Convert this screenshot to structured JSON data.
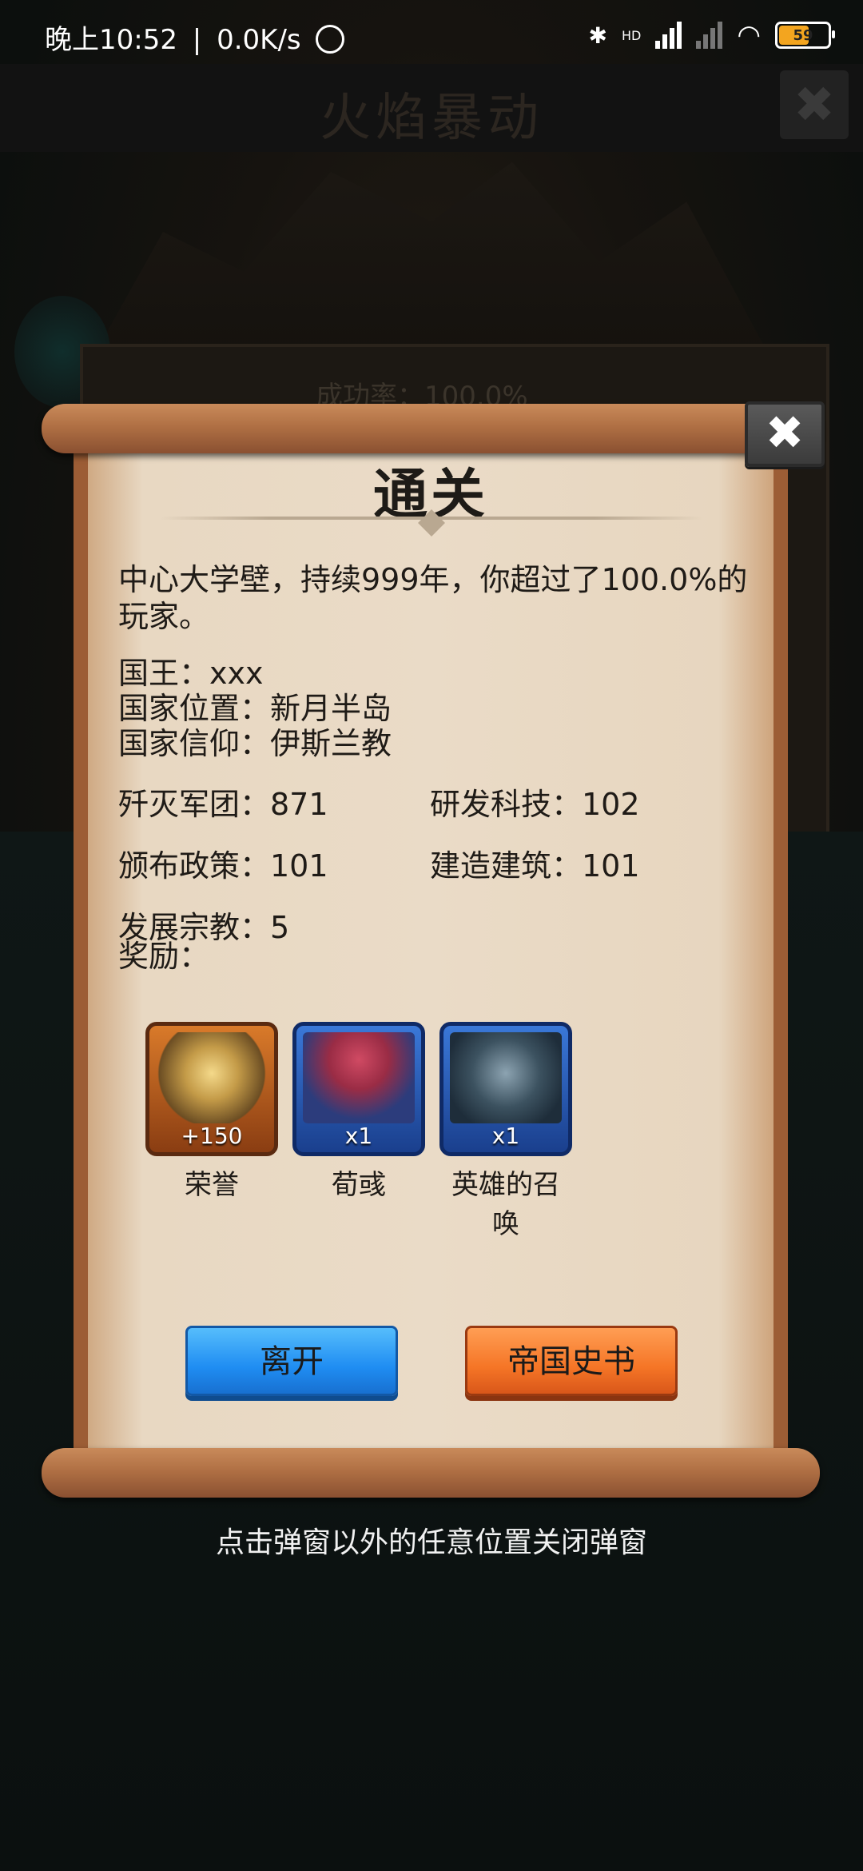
{
  "status_bar": {
    "time": "晚上10:52",
    "separator": "|",
    "speed": "0.0K/s",
    "battery": "59",
    "network_label": "HD"
  },
  "background": {
    "title": "火焰暴动",
    "panel_text": "成功率：100.0%"
  },
  "dialog": {
    "title": "通关",
    "summary": "中心大学壁，持续999年，你超过了100.0%的玩家。",
    "info": {
      "king": "国王：xxx",
      "location": "国家位置：新月半岛",
      "faith": "国家信仰：伊斯兰教"
    },
    "stats": {
      "destroyed_armies": "歼灭军团：871",
      "researched_tech": "研发科技：102",
      "policies": "颁布政策：101",
      "buildings": "建造建筑：101",
      "religion": "发展宗教：5"
    },
    "rewards_label": "奖励：",
    "rewards": [
      {
        "name": "荣誉",
        "count": "+150"
      },
      {
        "name": "荀彧",
        "count": "x1"
      },
      {
        "name": "英雄的召唤",
        "count": "x1"
      }
    ],
    "buttons": {
      "leave": "离开",
      "history": "帝国史书"
    },
    "close_symbol": "✖"
  },
  "hint": "点击弹窗以外的任意位置关闭弹窗",
  "colors": {
    "leave_button": "#1f8df2",
    "history_button": "#f57526",
    "paper": "#eadbc7"
  }
}
